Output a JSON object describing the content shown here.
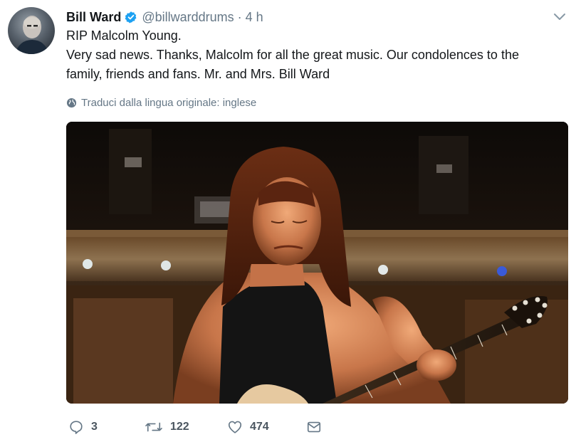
{
  "tweet": {
    "author_name": "Bill Ward",
    "handle": "@billwarddrums",
    "separator": "·",
    "time": "4 h",
    "text_line1": "RIP Malcolm Young.",
    "text_line2": "Very sad news.  Thanks, Malcolm for all the great music. Our condolences to the",
    "text_line3": "family, friends and fans.  Mr. and Mrs. Bill Ward",
    "translate_label": "Traduci dalla lingua originale: inglese"
  },
  "actions": {
    "replies": "3",
    "retweets": "122",
    "likes": "474"
  },
  "icons": {
    "verified": "verified-badge-icon",
    "caret": "chevron-down-icon",
    "globe": "globe-icon",
    "reply": "reply-icon",
    "retweet": "retweet-icon",
    "like": "heart-icon",
    "dm": "envelope-icon"
  },
  "colors": {
    "verified": "#1da1f2",
    "secondary_text": "#657786",
    "primary_text": "#14171a"
  }
}
